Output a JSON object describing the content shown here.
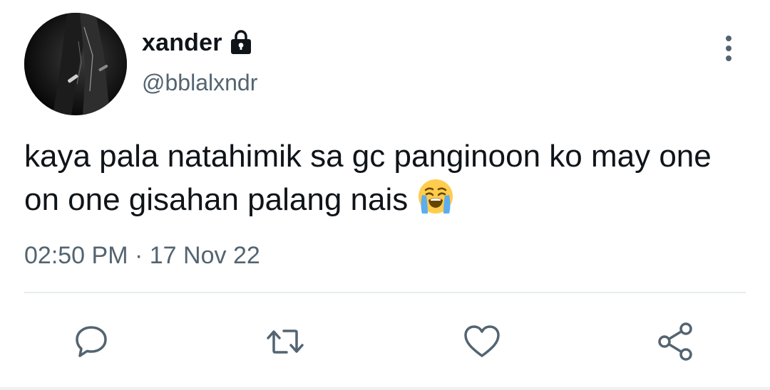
{
  "user": {
    "display_name": "xander",
    "handle": "@bblalxndr",
    "protected_icon": "lock-icon",
    "avatar": "profile-photo"
  },
  "tweet": {
    "text": "kaya pala natahimik sa gc panginoon ko may one on one gisahan palang nais",
    "emoji": "loudly-crying-face",
    "time": "02:50 PM",
    "separator": "·",
    "date": "17 Nov 22"
  },
  "actions": [
    {
      "name": "reply",
      "icon": "speech-bubble-icon"
    },
    {
      "name": "retweet",
      "icon": "retweet-icon"
    },
    {
      "name": "like",
      "icon": "heart-icon"
    },
    {
      "name": "share",
      "icon": "share-icon"
    }
  ],
  "menu": {
    "icon": "more-vertical-icon"
  },
  "colors": {
    "text_primary": "#0f1419",
    "text_secondary": "#536471",
    "divider": "#e7ebee",
    "background": "#ffffff"
  }
}
